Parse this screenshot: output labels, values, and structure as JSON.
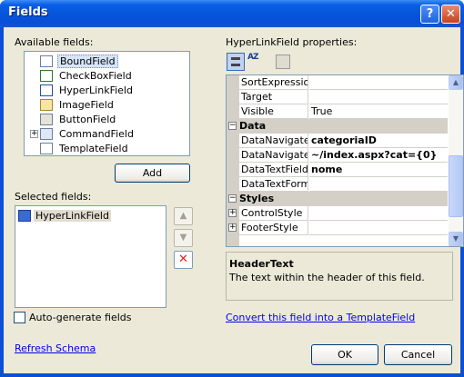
{
  "window": {
    "title": "Fields",
    "help_glyph": "?",
    "close_glyph": "✕"
  },
  "available_fields": {
    "label": "Available fields:",
    "items": [
      {
        "label": "BoundField",
        "icon": "bound-field-icon"
      },
      {
        "label": "CheckBoxField",
        "icon": "checkbox-field-icon"
      },
      {
        "label": "HyperLinkField",
        "icon": "hyperlink-field-icon"
      },
      {
        "label": "ImageField",
        "icon": "image-field-icon"
      },
      {
        "label": "ButtonField",
        "icon": "button-field-icon"
      },
      {
        "label": "CommandField",
        "icon": "command-field-icon",
        "expander": "+"
      },
      {
        "label": "TemplateField",
        "icon": "template-field-icon"
      }
    ]
  },
  "add_button": "Add",
  "selected_fields": {
    "label": "Selected fields:",
    "items": [
      {
        "label": "HyperLinkField",
        "icon": "hyperlink-field-icon"
      }
    ]
  },
  "move_buttons": {
    "up_glyph": "▲",
    "down_glyph": "▼",
    "delete_glyph": "✕"
  },
  "auto_generate": {
    "label": "Auto-generate fields",
    "checked": false
  },
  "refresh_schema": "Refresh Schema",
  "properties": {
    "label": "HyperLinkField properties:",
    "sort_alpha_label": "AZ",
    "rows": [
      {
        "kind": "prop",
        "name": "SortExpression",
        "value": ""
      },
      {
        "kind": "prop",
        "name": "Target",
        "value": ""
      },
      {
        "kind": "prop",
        "name": "Visible",
        "value": "True"
      },
      {
        "kind": "cat",
        "name": "Data",
        "expander": "−"
      },
      {
        "kind": "prop",
        "name": "DataNavigateU",
        "value": "categoriaID",
        "bold": true
      },
      {
        "kind": "prop",
        "name": "DataNavigateU",
        "value": "~/index.aspx?cat={0}",
        "bold": true
      },
      {
        "kind": "prop",
        "name": "DataTextField",
        "value": "nome",
        "bold": true
      },
      {
        "kind": "prop",
        "name": "DataTextForma",
        "value": ""
      },
      {
        "kind": "cat",
        "name": "Styles",
        "expander": "−"
      },
      {
        "kind": "prop",
        "name": "ControlStyle",
        "value": "",
        "expander": "+"
      },
      {
        "kind": "prop",
        "name": "FooterStyle",
        "value": "",
        "expander": "+"
      }
    ],
    "description_title": "HeaderText",
    "description_text": "The text within the header of this field."
  },
  "convert_link": "Convert this field into a TemplateField",
  "ok_button": "OK",
  "cancel_button": "Cancel",
  "colors": {
    "titlebar": "#0a5ee6",
    "dialog_bg": "#ece9d8",
    "link": "#0000ee",
    "delete": "#d8281c"
  }
}
